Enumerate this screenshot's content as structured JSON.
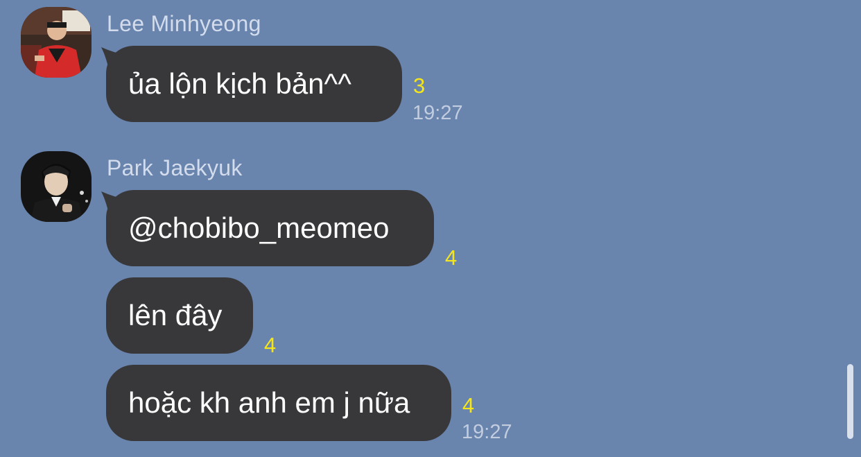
{
  "messages": [
    {
      "sender": "Lee Minhyeong",
      "avatar_icon": "user-avatar-lee-minhyeong",
      "bubbles": [
        {
          "text": "ủa lộn kịch bản^^",
          "unread": "3",
          "time": "19:27"
        }
      ]
    },
    {
      "sender": "Park Jaekyuk",
      "avatar_icon": "user-avatar-park-jaekyuk",
      "bubbles": [
        {
          "text": "@chobibo_meomeo",
          "unread": "4"
        },
        {
          "text": "lên đây",
          "unread": "4"
        },
        {
          "text": "hoặc kh anh em j nữa",
          "unread": "4",
          "time": "19:27"
        }
      ]
    }
  ],
  "colors": {
    "background": "#6984ad",
    "bubble": "#38383b",
    "unread": "#f5e61c",
    "time": "#c2cde0"
  }
}
